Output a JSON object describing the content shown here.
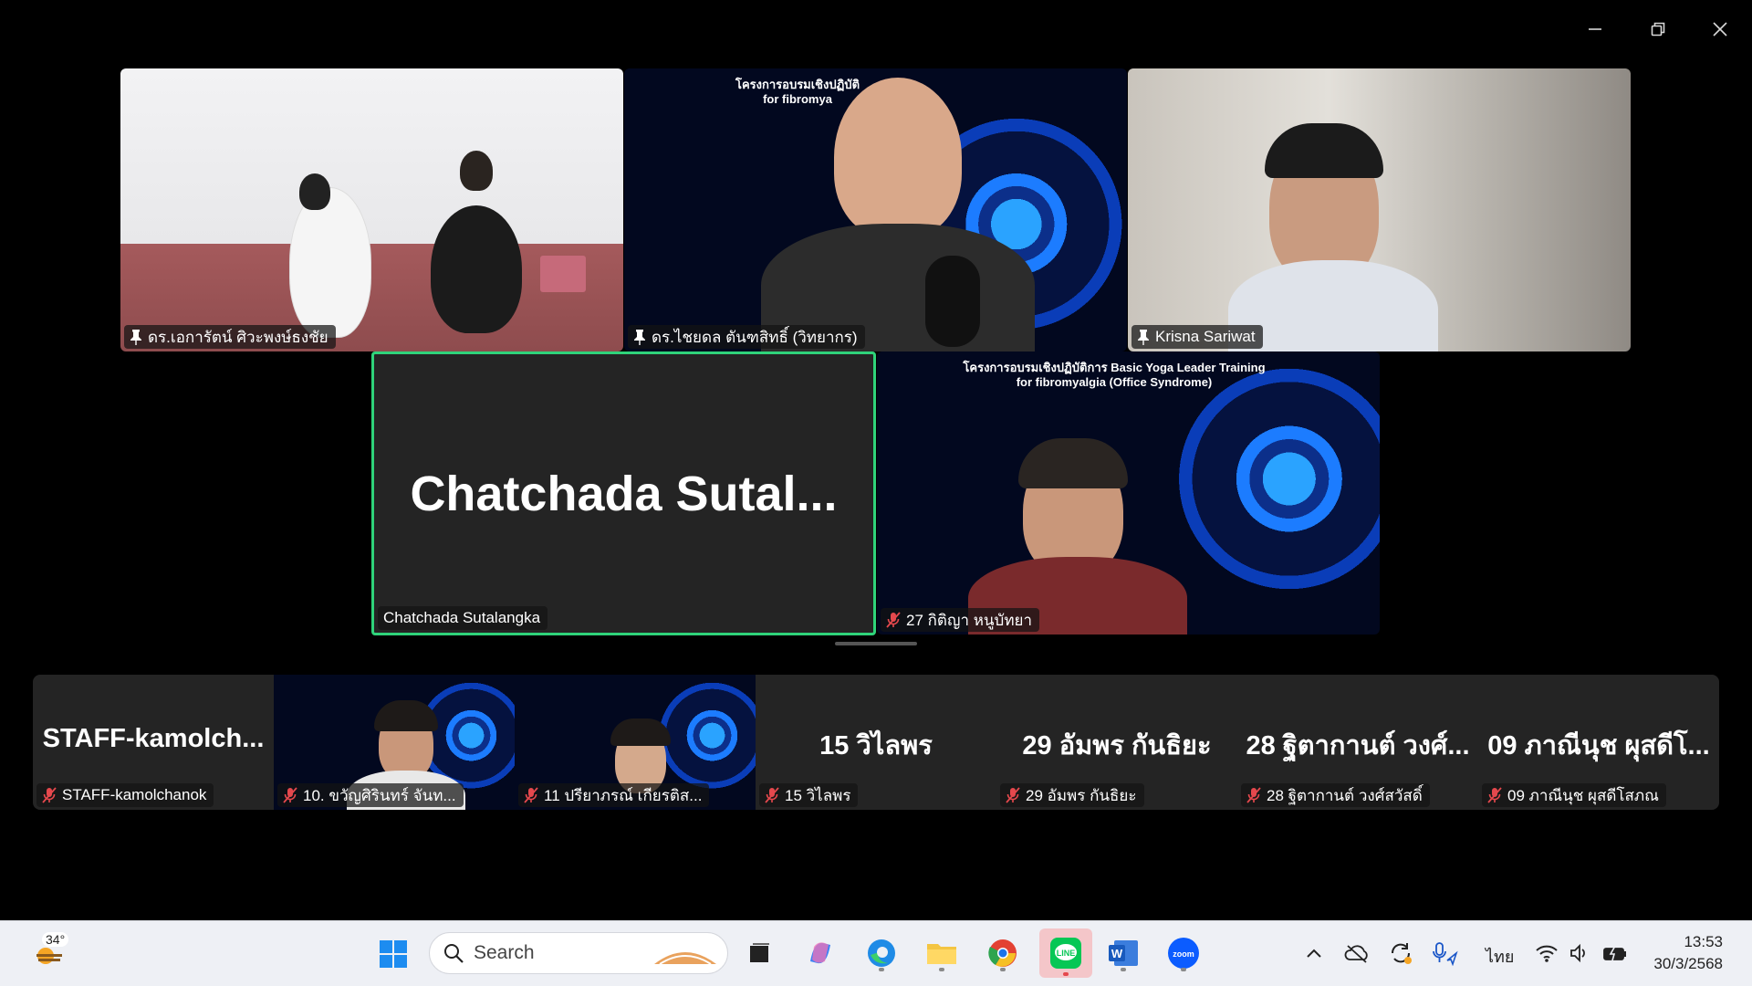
{
  "window": {
    "controls": [
      "minimize",
      "restore",
      "close"
    ]
  },
  "gallery": {
    "top_row": [
      {
        "name": "ดร.เอการัตน์ ศิวะพงษ์ธงชัย",
        "pinned": true
      },
      {
        "name": "ดร.ไชยดล ตันฑสิทธิ์ (วิทยากร)",
        "pinned": true,
        "banner": "โครงการอบรมเชิงปฏิบัติ\nfor fibromya"
      },
      {
        "name": "Krisna Sariwat",
        "pinned": true
      }
    ],
    "middle_row": [
      {
        "name": "Chatchada Sutalangka",
        "big_name": "Chatchada  Sutal...",
        "speaking": true
      },
      {
        "name": "27 กิติญา หนูบัทยา",
        "muted": true,
        "banner": "โครงการอบรมเชิงปฏิบัติการ Basic Yoga Leader Training\nfor fibromyalgia (Office Syndrome)"
      }
    ]
  },
  "strip": [
    {
      "big_name": "STAFF-kamolch...",
      "name": "STAFF-kamolchanok",
      "muted": true
    },
    {
      "name": "10. ขวัญศิรินทร์ จันท...",
      "muted": true,
      "video": true
    },
    {
      "name": "11 ปรียาภรณ์ เกียรติส...",
      "muted": true,
      "video": true
    },
    {
      "big_name": "15 วิไลพร",
      "name": "15 วิไลพร",
      "muted": true
    },
    {
      "big_name": "29 อัมพร  กันธิยะ",
      "name": "29 อัมพร  กันธิยะ",
      "muted": true
    },
    {
      "big_name": "28 ฐิตากานต์ วงศ์...",
      "name": "28 ฐิตากานต์ วงศ์สวัสดิ์",
      "muted": true
    },
    {
      "big_name": "09 ภาณีนุช ผุสดีโ...",
      "name": "09 ภาณีนุช ผุสดีโสภณ",
      "muted": true
    }
  ],
  "taskbar": {
    "weather": "34°",
    "search_placeholder": "Search",
    "apps": [
      "windows-start",
      "task-view",
      "copilot",
      "edge",
      "file-explorer",
      "chrome",
      "line",
      "word",
      "zoom"
    ],
    "tray": {
      "language": "ไทย",
      "time": "13:53",
      "date": "30/3/2568"
    }
  },
  "colors": {
    "speaker_border": "#2fd37a",
    "muted_icon": "#e5484d",
    "tile_bg": "#242424"
  }
}
